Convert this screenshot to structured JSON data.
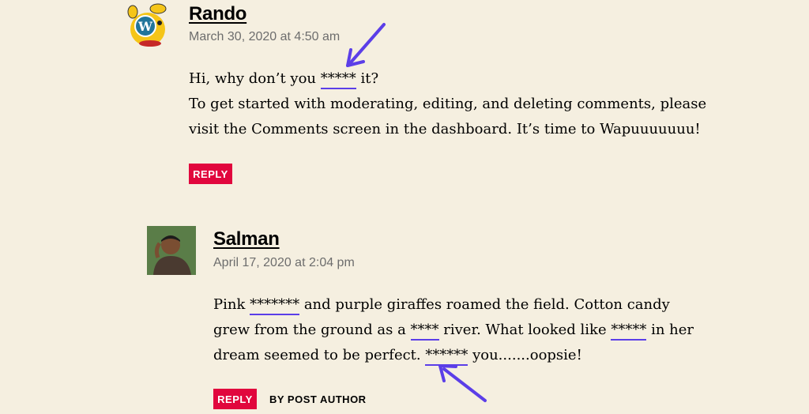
{
  "comments": [
    {
      "author": "Rando",
      "date": "March 30, 2020 at 4:50 am",
      "lines": [
        {
          "parts": [
            "Hi, why don’t you ",
            "*****",
            " it?"
          ]
        },
        {
          "parts": [
            "To get started with moderating, editing, and deleting comments, please"
          ]
        },
        {
          "parts": [
            "visit the Comments screen in the dashboard. It’s time to Wapuuuuuuu!"
          ]
        }
      ],
      "reply_label": "REPLY",
      "avatar_icon": "wapuu-wordpress-mascot-icon"
    },
    {
      "author": "Salman",
      "date": "April 17, 2020 at 2:04 pm",
      "lines": [
        {
          "parts": [
            "Pink ",
            "*******",
            " and purple giraffes roamed the field. Cotton candy"
          ]
        },
        {
          "parts": [
            "grew from the ground as a ",
            "****",
            " river. What looked like ",
            "*****",
            " in her"
          ]
        },
        {
          "parts": [
            "dream seemed to be perfect. ",
            "******",
            " you.......oopsie!"
          ]
        }
      ],
      "reply_label": "REPLY",
      "badge": "BY POST AUTHOR",
      "avatar_icon": "user-photo-avatar"
    }
  ],
  "annotation_color": "#5b3ee8",
  "accent_color": "#e1063d"
}
